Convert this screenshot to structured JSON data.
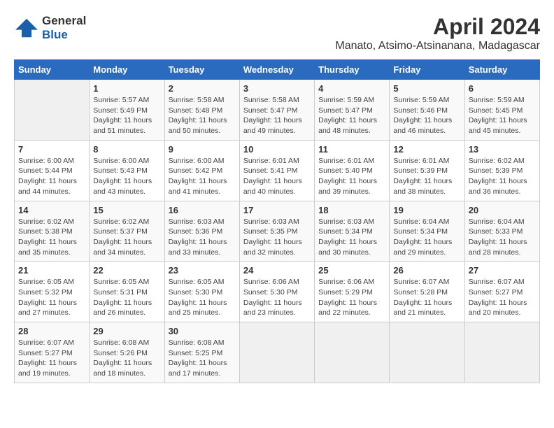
{
  "logo": {
    "line1": "General",
    "line2": "Blue"
  },
  "title": "April 2024",
  "subtitle": "Manato, Atsimo-Atsinanana, Madagascar",
  "columns": [
    "Sunday",
    "Monday",
    "Tuesday",
    "Wednesday",
    "Thursday",
    "Friday",
    "Saturday"
  ],
  "weeks": [
    [
      {
        "day": "",
        "info": ""
      },
      {
        "day": "1",
        "info": "Sunrise: 5:57 AM\nSunset: 5:49 PM\nDaylight: 11 hours\nand 51 minutes."
      },
      {
        "day": "2",
        "info": "Sunrise: 5:58 AM\nSunset: 5:48 PM\nDaylight: 11 hours\nand 50 minutes."
      },
      {
        "day": "3",
        "info": "Sunrise: 5:58 AM\nSunset: 5:47 PM\nDaylight: 11 hours\nand 49 minutes."
      },
      {
        "day": "4",
        "info": "Sunrise: 5:59 AM\nSunset: 5:47 PM\nDaylight: 11 hours\nand 48 minutes."
      },
      {
        "day": "5",
        "info": "Sunrise: 5:59 AM\nSunset: 5:46 PM\nDaylight: 11 hours\nand 46 minutes."
      },
      {
        "day": "6",
        "info": "Sunrise: 5:59 AM\nSunset: 5:45 PM\nDaylight: 11 hours\nand 45 minutes."
      }
    ],
    [
      {
        "day": "7",
        "info": "Sunrise: 6:00 AM\nSunset: 5:44 PM\nDaylight: 11 hours\nand 44 minutes."
      },
      {
        "day": "8",
        "info": "Sunrise: 6:00 AM\nSunset: 5:43 PM\nDaylight: 11 hours\nand 43 minutes."
      },
      {
        "day": "9",
        "info": "Sunrise: 6:00 AM\nSunset: 5:42 PM\nDaylight: 11 hours\nand 41 minutes."
      },
      {
        "day": "10",
        "info": "Sunrise: 6:01 AM\nSunset: 5:41 PM\nDaylight: 11 hours\nand 40 minutes."
      },
      {
        "day": "11",
        "info": "Sunrise: 6:01 AM\nSunset: 5:40 PM\nDaylight: 11 hours\nand 39 minutes."
      },
      {
        "day": "12",
        "info": "Sunrise: 6:01 AM\nSunset: 5:39 PM\nDaylight: 11 hours\nand 38 minutes."
      },
      {
        "day": "13",
        "info": "Sunrise: 6:02 AM\nSunset: 5:39 PM\nDaylight: 11 hours\nand 36 minutes."
      }
    ],
    [
      {
        "day": "14",
        "info": "Sunrise: 6:02 AM\nSunset: 5:38 PM\nDaylight: 11 hours\nand 35 minutes."
      },
      {
        "day": "15",
        "info": "Sunrise: 6:02 AM\nSunset: 5:37 PM\nDaylight: 11 hours\nand 34 minutes."
      },
      {
        "day": "16",
        "info": "Sunrise: 6:03 AM\nSunset: 5:36 PM\nDaylight: 11 hours\nand 33 minutes."
      },
      {
        "day": "17",
        "info": "Sunrise: 6:03 AM\nSunset: 5:35 PM\nDaylight: 11 hours\nand 32 minutes."
      },
      {
        "day": "18",
        "info": "Sunrise: 6:03 AM\nSunset: 5:34 PM\nDaylight: 11 hours\nand 30 minutes."
      },
      {
        "day": "19",
        "info": "Sunrise: 6:04 AM\nSunset: 5:34 PM\nDaylight: 11 hours\nand 29 minutes."
      },
      {
        "day": "20",
        "info": "Sunrise: 6:04 AM\nSunset: 5:33 PM\nDaylight: 11 hours\nand 28 minutes."
      }
    ],
    [
      {
        "day": "21",
        "info": "Sunrise: 6:05 AM\nSunset: 5:32 PM\nDaylight: 11 hours\nand 27 minutes."
      },
      {
        "day": "22",
        "info": "Sunrise: 6:05 AM\nSunset: 5:31 PM\nDaylight: 11 hours\nand 26 minutes."
      },
      {
        "day": "23",
        "info": "Sunrise: 6:05 AM\nSunset: 5:30 PM\nDaylight: 11 hours\nand 25 minutes."
      },
      {
        "day": "24",
        "info": "Sunrise: 6:06 AM\nSunset: 5:30 PM\nDaylight: 11 hours\nand 23 minutes."
      },
      {
        "day": "25",
        "info": "Sunrise: 6:06 AM\nSunset: 5:29 PM\nDaylight: 11 hours\nand 22 minutes."
      },
      {
        "day": "26",
        "info": "Sunrise: 6:07 AM\nSunset: 5:28 PM\nDaylight: 11 hours\nand 21 minutes."
      },
      {
        "day": "27",
        "info": "Sunrise: 6:07 AM\nSunset: 5:27 PM\nDaylight: 11 hours\nand 20 minutes."
      }
    ],
    [
      {
        "day": "28",
        "info": "Sunrise: 6:07 AM\nSunset: 5:27 PM\nDaylight: 11 hours\nand 19 minutes."
      },
      {
        "day": "29",
        "info": "Sunrise: 6:08 AM\nSunset: 5:26 PM\nDaylight: 11 hours\nand 18 minutes."
      },
      {
        "day": "30",
        "info": "Sunrise: 6:08 AM\nSunset: 5:25 PM\nDaylight: 11 hours\nand 17 minutes."
      },
      {
        "day": "",
        "info": ""
      },
      {
        "day": "",
        "info": ""
      },
      {
        "day": "",
        "info": ""
      },
      {
        "day": "",
        "info": ""
      }
    ]
  ]
}
